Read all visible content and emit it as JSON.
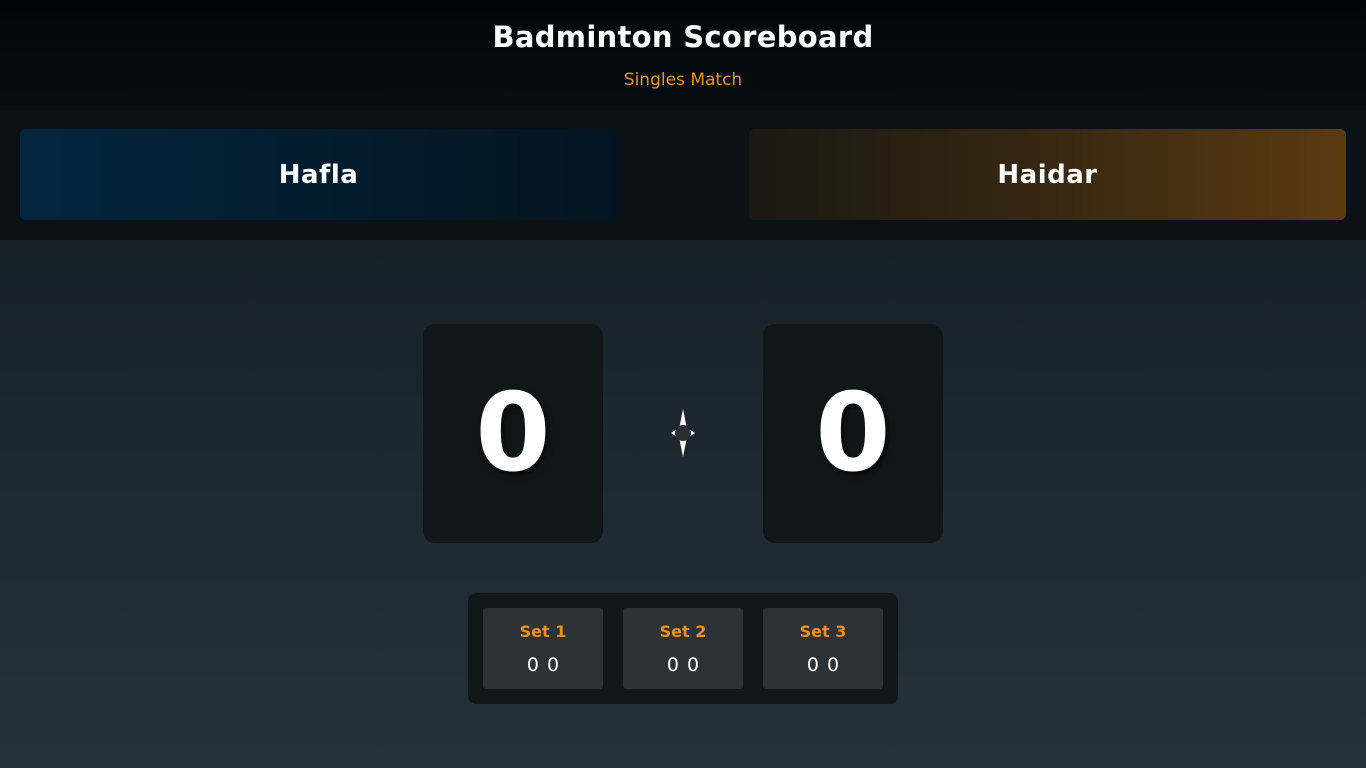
{
  "header": {
    "title": "Badminton Scoreboard",
    "subtitle": "Singles Match"
  },
  "players": {
    "left": {
      "name": "Hafla",
      "score": "0"
    },
    "right": {
      "name": "Haidar",
      "score": "0"
    }
  },
  "serve_indicator": {
    "icon": "shuttlecock-icon"
  },
  "sets": [
    {
      "label": "Set 1",
      "left": "0",
      "right": "0"
    },
    {
      "label": "Set 2",
      "left": "0",
      "right": "0"
    },
    {
      "label": "Set 3",
      "left": "0",
      "right": "0"
    }
  ],
  "colors": {
    "accent": "#f0901a",
    "left_player": "#03263f",
    "right_player": "#5a3a11"
  }
}
